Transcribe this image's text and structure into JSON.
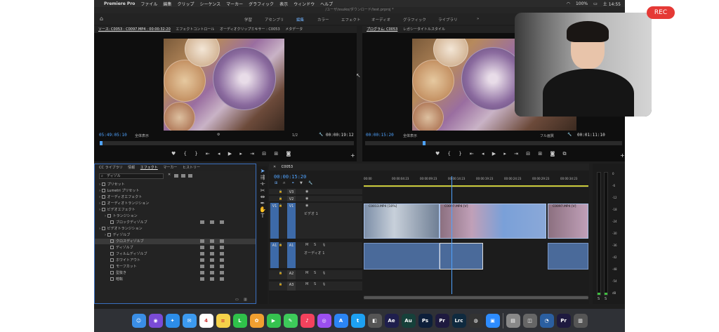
{
  "menubar": {
    "items": [
      "Premiere Pro",
      "ファイル",
      "編集",
      "クリップ",
      "シーケンス",
      "マーカー",
      "グラフィック",
      "表示",
      "ウィンドウ",
      "ヘルプ"
    ],
    "battery": "100%",
    "time": "土 14:55"
  },
  "title_path": "/ユーザ/ssuiko/ダウンロード/test.prproj *",
  "workspaces": [
    "学習",
    "アセンブリ",
    "編集",
    "カラー",
    "エフェクト",
    "オーディオ",
    "グラフィック",
    "ライブラリ"
  ],
  "source_panel": {
    "tabs": [
      "ソース: C0053 : C0097.MP4 : 00:00:32:20",
      "エフェクトコントロール",
      "オーディオクリップミキサー : C0053",
      "メタデータ"
    ],
    "timecode_in": "05:49:05:10",
    "fit": "全体表示",
    "ratio": "1/2",
    "timecode_out": "00:00:19:12"
  },
  "program_panel": {
    "tabs": [
      "プログラム: C0053",
      "レガシータイトルスタイル"
    ],
    "timecode_in": "00:00:15:20",
    "fit": "全体表示",
    "quality": "フル画質",
    "timecode_out": "00:01:11:10"
  },
  "effects_panel": {
    "tabs": [
      "CC ライブラリ",
      "情報",
      "エフェクト",
      "マーカー",
      "ヒストリー"
    ],
    "search_value": "ディゾル",
    "items": [
      {
        "label": "プリセット",
        "level": 0,
        "selected": false
      },
      {
        "label": "Lumetri プリセット",
        "level": 0,
        "selected": false
      },
      {
        "label": "オーディオエフェクト",
        "level": 0,
        "selected": false
      },
      {
        "label": "オーディオトランジション",
        "level": 0,
        "selected": false
      },
      {
        "label": "ビデオエフェクト",
        "level": 0,
        "selected": false
      },
      {
        "label": "トランジション",
        "level": 1,
        "selected": false
      },
      {
        "label": "ブロックディゾルブ",
        "level": 2,
        "selected": false
      },
      {
        "label": "ビデオトランジション",
        "level": 0,
        "selected": false
      },
      {
        "label": "ディゾルブ",
        "level": 1,
        "selected": false
      },
      {
        "label": "クロスディゾルブ",
        "level": 2,
        "selected": true
      },
      {
        "label": "ディゾルブ",
        "level": 2,
        "selected": false
      },
      {
        "label": "フィルムディゾルブ",
        "level": 2,
        "selected": false
      },
      {
        "label": "ホワイトアウト",
        "level": 2,
        "selected": false
      },
      {
        "label": "モーフカット",
        "level": 2,
        "selected": false
      },
      {
        "label": "型抜き",
        "level": 2,
        "selected": false
      },
      {
        "label": "暗転",
        "level": 2,
        "selected": false
      }
    ]
  },
  "timeline": {
    "sequence_tab": "C0053",
    "timecode": "00:00:15:20",
    "ruler": [
      "00:00",
      "00:00:04:23",
      "00:00:09:23",
      "00:00:14:23",
      "00:00:19:23",
      "00:00:24:23",
      "00:00:29:23",
      "00:00:34:23"
    ],
    "tracks": [
      {
        "left": "",
        "name": "V3"
      },
      {
        "left": "",
        "name": "V2"
      },
      {
        "left": "V1",
        "name": "V1",
        "label": "ビデオ 1"
      },
      {
        "left": "A1",
        "name": "A1",
        "label": "オーディオ 1"
      },
      {
        "left": "",
        "name": "A2"
      },
      {
        "left": "",
        "name": "A3"
      }
    ],
    "video_clips": [
      "C0013.MP4 [10%]",
      "C0097.MP4 [V]",
      "C0097.MP4 [V]"
    ]
  },
  "meter": {
    "scale": [
      "0",
      "-6",
      "-12",
      "-18",
      "-24",
      "-30",
      "-36",
      "-42",
      "-48",
      "-54",
      "dB"
    ],
    "channels": [
      "S",
      "S"
    ]
  },
  "dock": [
    {
      "name": "finder",
      "label": "☺",
      "color": "#3a8ee6"
    },
    {
      "name": "siri",
      "label": "◉",
      "color": "#7a4bd6"
    },
    {
      "name": "safari",
      "label": "✦",
      "color": "#2c8de8"
    },
    {
      "name": "mail",
      "label": "✉",
      "color": "#3c9af0"
    },
    {
      "name": "calendar",
      "label": "4",
      "color": "#ffffff"
    },
    {
      "name": "notes",
      "label": "≡",
      "color": "#f5d24a"
    },
    {
      "name": "line",
      "label": "L",
      "color": "#2fc14a"
    },
    {
      "name": "photos",
      "label": "✿",
      "color": "#f0a030"
    },
    {
      "name": "facetime",
      "label": "▶",
      "color": "#35c24f"
    },
    {
      "name": "messages",
      "label": "✎",
      "color": "#3dcb5a"
    },
    {
      "name": "music",
      "label": "♪",
      "color": "#f4425d"
    },
    {
      "name": "podcasts",
      "label": "◎",
      "color": "#9b4ff0"
    },
    {
      "name": "appstore",
      "label": "A",
      "color": "#2b85f4"
    },
    {
      "name": "twitter",
      "label": "t",
      "color": "#1da1f2"
    },
    {
      "name": "screenshot",
      "label": "◧",
      "color": "#555555"
    },
    {
      "name": "after-effects",
      "label": "Ae",
      "color": "#1f1f4d"
    },
    {
      "name": "audition",
      "label": "Au",
      "color": "#16403a"
    },
    {
      "name": "photoshop",
      "label": "Ps",
      "color": "#0d1f3a"
    },
    {
      "name": "premiere-pro",
      "label": "Pr",
      "color": "#1e1a3f"
    },
    {
      "name": "lightroom-classic",
      "label": "Lrc",
      "color": "#0f2a3f"
    },
    {
      "name": "davinci",
      "label": "◍",
      "color": "#333333"
    },
    {
      "name": "zoom",
      "label": "▣",
      "color": "#2d8cff"
    },
    {
      "name": "sep",
      "label": "",
      "color": ""
    },
    {
      "name": "files",
      "label": "▤",
      "color": "#888888"
    },
    {
      "name": "preview",
      "label": "◫",
      "color": "#666666"
    },
    {
      "name": "activity",
      "label": "◔",
      "color": "#2b5fa0"
    },
    {
      "name": "premiere-doc",
      "label": "Pr",
      "color": "#1e1a3f"
    },
    {
      "name": "trash",
      "label": "▥",
      "color": "#555555"
    }
  ],
  "rec_label": "REC",
  "colors": {
    "accent_blue": "#4fa3ff",
    "rec_red": "#e53935",
    "clip_video": "#8aa8d8",
    "clip_audio": "#4a6a9a"
  }
}
